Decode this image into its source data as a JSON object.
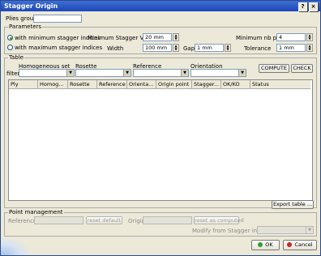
{
  "window": {
    "title": "Stagger Origin",
    "help": "?",
    "close": "×"
  },
  "plies_group": {
    "label": "Plies group",
    "value": ""
  },
  "parameters": {
    "title": "Parameters",
    "radio_min": "with minimum stagger indices",
    "radio_max": "with maximum stagger indices",
    "min_stagger_label": "Minimum Stagger Value",
    "min_stagger_value": "20 mm",
    "min_plies_label": "Minimum nb plies",
    "min_plies_value": "4",
    "width_label": "Width",
    "width_value": "100 mm",
    "gap_label": "Gap",
    "gap_value": "1 mm",
    "tolerance_label": "Tolerance",
    "tolerance_value": "1 mm"
  },
  "table": {
    "title": "Table",
    "filter_label": "filter",
    "filters": [
      "Homogeneous set",
      "Rosette",
      "Reference",
      "Orientation"
    ],
    "compute": "COMPUTE",
    "check": "CHECK",
    "columns": [
      "Ply",
      "Homog...",
      "Rosette",
      "Reference",
      "Orienta...",
      "Origin point",
      "Stagger...",
      "OK/KO",
      "Status"
    ],
    "export": "Export table ..."
  },
  "point_management": {
    "title": "Point management",
    "reference_label": "Reference",
    "reset_default": "reset default",
    "origin_label": "Origin",
    "reset_computed": "reset as computed",
    "modify_label": "Modify from Stagger index"
  },
  "buttons": {
    "ok": "OK",
    "cancel": "Cancel"
  }
}
